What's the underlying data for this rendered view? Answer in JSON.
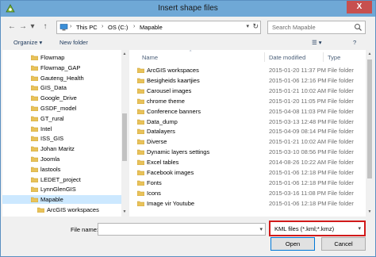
{
  "window": {
    "title": "Insert shape files",
    "close_glyph": "X"
  },
  "nav_buttons": {
    "back_glyph": "←",
    "forward_glyph": "→",
    "up_glyph": "↑",
    "recent_glyph": "▾"
  },
  "address": {
    "crumbs": [
      "This PC",
      "OS (C:)",
      "Mapable"
    ],
    "separator_glyph": "›",
    "dropdown_glyph": "▾",
    "refresh_glyph": "↻"
  },
  "search": {
    "placeholder": "Search Mapable"
  },
  "toolbar": {
    "organize_label": "Organize ▾",
    "new_folder_label": "New folder",
    "view_glyph": "☰ ▾",
    "help_glyph": "?"
  },
  "nav_tree": [
    {
      "label": "Flowmap",
      "selected": false,
      "indent": 0
    },
    {
      "label": "Flowmap_GAP",
      "selected": false,
      "indent": 0
    },
    {
      "label": "Gauteng_Health",
      "selected": false,
      "indent": 0
    },
    {
      "label": "GIS_Data",
      "selected": false,
      "indent": 0
    },
    {
      "label": "Google_Drive",
      "selected": false,
      "indent": 0
    },
    {
      "label": "GSDF_model",
      "selected": false,
      "indent": 0
    },
    {
      "label": "GT_rural",
      "selected": false,
      "indent": 0
    },
    {
      "label": "Intel",
      "selected": false,
      "indent": 0
    },
    {
      "label": "ISS_GIS",
      "selected": false,
      "indent": 0
    },
    {
      "label": "Johan Maritz",
      "selected": false,
      "indent": 0
    },
    {
      "label": "Joomla",
      "selected": false,
      "indent": 0
    },
    {
      "label": "lastools",
      "selected": false,
      "indent": 0
    },
    {
      "label": "LEDET_project",
      "selected": false,
      "indent": 0
    },
    {
      "label": "LynnGlenGIS",
      "selected": false,
      "indent": 0
    },
    {
      "label": "Mapable",
      "selected": true,
      "indent": 0
    },
    {
      "label": "ArcGIS workspaces",
      "selected": false,
      "indent": 1
    }
  ],
  "columns": {
    "name": "Name",
    "date": "Date modified",
    "type": "Type",
    "sort_glyph": "^"
  },
  "files": [
    {
      "name": "ArcGIS workspaces",
      "date": "2015-01-20 11:37 PM",
      "type": "File folder"
    },
    {
      "name": "Besigheids kaartjies",
      "date": "2015-01-06 12:16 PM",
      "type": "File folder"
    },
    {
      "name": "Carousel images",
      "date": "2015-01-21 10:02 AM",
      "type": "File folder"
    },
    {
      "name": "chrome theme",
      "date": "2015-01-20 11:05 PM",
      "type": "File folder"
    },
    {
      "name": "Conference banners",
      "date": "2015-04-08 11:03 PM",
      "type": "File folder"
    },
    {
      "name": "Data_dump",
      "date": "2015-03-13 12:48 PM",
      "type": "File folder"
    },
    {
      "name": "Datalayers",
      "date": "2015-04-09 08:14 PM",
      "type": "File folder"
    },
    {
      "name": "Diverse",
      "date": "2015-01-21 10:02 AM",
      "type": "File folder"
    },
    {
      "name": "Dynamic layers settings",
      "date": "2015-03-10 08:56 PM",
      "type": "File folder"
    },
    {
      "name": "Excel tables",
      "date": "2014-08-26 10:22 AM",
      "type": "File folder"
    },
    {
      "name": "Facebook images",
      "date": "2015-01-06 12:18 PM",
      "type": "File folder"
    },
    {
      "name": "Fonts",
      "date": "2015-01-06 12:18 PM",
      "type": "File folder"
    },
    {
      "name": "Icons",
      "date": "2015-03-16 11:08 PM",
      "type": "File folder"
    },
    {
      "name": "Image vir Youtube",
      "date": "2015-01-06 12:18 PM",
      "type": "File folder"
    }
  ],
  "bottom": {
    "file_name_label": "File name:",
    "file_name_value": "",
    "filter_value": "KML files (*.kml;*.kmz)",
    "dropdown_glyph": "▾",
    "open_label": "Open",
    "cancel_label": "Cancel"
  },
  "colors": {
    "titlebar": "#6fa8d6",
    "selection": "#cce8ff",
    "folder": "#e8c25a",
    "highlight_border": "#d11a1a"
  }
}
